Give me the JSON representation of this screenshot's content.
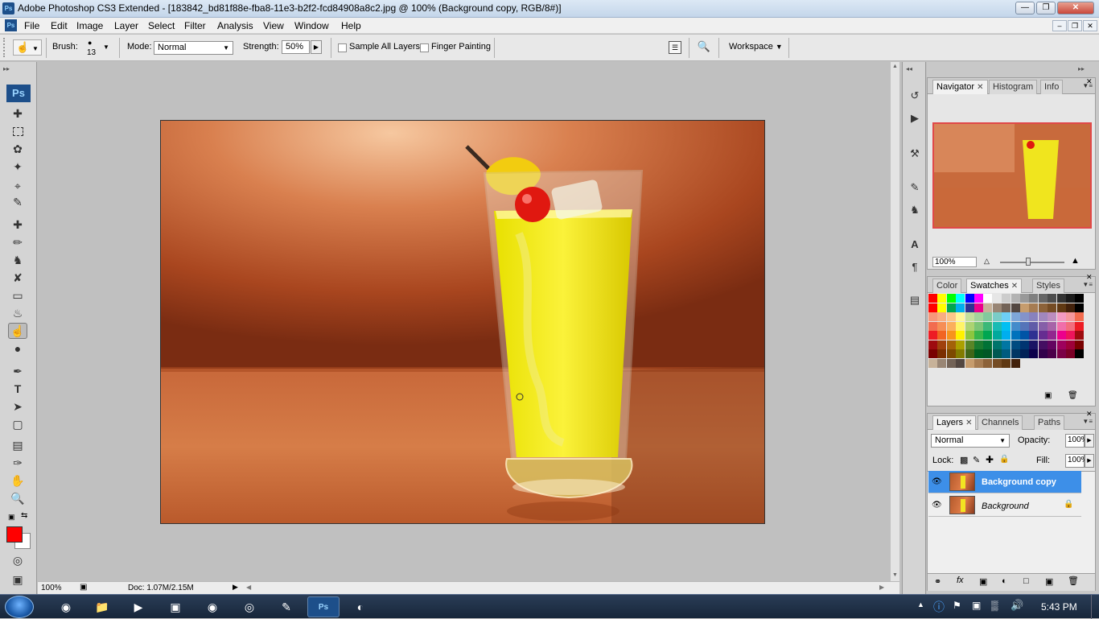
{
  "window": {
    "title": "Adobe Photoshop CS3 Extended - [183842_bd81f88e-fba8-11e3-b2f2-fcd84908a8c2.jpg @ 100% (Background copy, RGB/8#)]",
    "app_icon": "Ps"
  },
  "menu": [
    "File",
    "Edit",
    "Image",
    "Layer",
    "Select",
    "Filter",
    "Analysis",
    "View",
    "Window",
    "Help"
  ],
  "options": {
    "brush_label": "Brush:",
    "brush_size": "13",
    "mode_label": "Mode:",
    "mode_value": "Normal",
    "strength_label": "Strength:",
    "strength_value": "50%",
    "sample_all_layers": "Sample All Layers",
    "finger_painting": "Finger Painting",
    "workspace": "Workspace"
  },
  "tools_header": "Ps",
  "status": {
    "zoom": "100%",
    "doc": "Doc: 1.07M/2.15M"
  },
  "navigator": {
    "tabs": [
      "Navigator",
      "Histogram",
      "Info"
    ],
    "zoom": "100%"
  },
  "swatches": {
    "tabs": [
      "Color",
      "Swatches",
      "Styles"
    ],
    "rows": [
      [
        "#ff0000",
        "#ffff00",
        "#00ff00",
        "#00ffff",
        "#0000ff",
        "#ff00ff",
        "#ffffff",
        "#e6e6e6",
        "#cccccc",
        "#b3b3b3",
        "#999999",
        "#808080",
        "#666666",
        "#4d4d4d",
        "#333333",
        "#1a1a1a",
        "#000000"
      ],
      [
        "#ff0000",
        "#ffff00",
        "#00a651",
        "#00aeef",
        "#2e3192",
        "#ec008c",
        "#c7b299",
        "#998675",
        "#736357",
        "#534741",
        "#c69c6d",
        "#a67c52",
        "#8c6239",
        "#754c24",
        "#603913",
        "#42210b",
        "#000000"
      ],
      [
        "#f7977a",
        "#f9ad81",
        "#fdc68a",
        "#fff79a",
        "#c4df9b",
        "#a3d39c",
        "#82ca9d",
        "#7accc8",
        "#6dcff6",
        "#7ea7d8",
        "#8493ca",
        "#8882be",
        "#a187be",
        "#bc8dbf",
        "#f49ac2",
        "#f6989d",
        "#f26c4f"
      ],
      [
        "#f26c4f",
        "#f68e55",
        "#fbaf5c",
        "#fff467",
        "#acd372",
        "#7cc576",
        "#3bb878",
        "#1abbb4",
        "#00bff3",
        "#438ccb",
        "#5574b9",
        "#605ca8",
        "#855fa8",
        "#a763a8",
        "#f06eaa",
        "#f26d7d",
        "#ed1c24"
      ],
      [
        "#ed1c24",
        "#f26522",
        "#f7941d",
        "#fff200",
        "#8dc63f",
        "#39b54a",
        "#00a651",
        "#00a99d",
        "#00aeef",
        "#0072bc",
        "#0054a6",
        "#2e3192",
        "#662d91",
        "#92278f",
        "#ec008c",
        "#ed145b",
        "#9e0b0f"
      ],
      [
        "#9e0b0f",
        "#a0410d",
        "#a36209",
        "#aba000",
        "#598527",
        "#1a7b30",
        "#007236",
        "#00746b",
        "#0076a3",
        "#004b80",
        "#003471",
        "#1b1464",
        "#440e62",
        "#630460",
        "#9e005d",
        "#9e0039",
        "#790000"
      ],
      [
        "#790000",
        "#7b2e00",
        "#7d4900",
        "#827b00",
        "#406618",
        "#005e20",
        "#005826",
        "#005952",
        "#005b7f",
        "#003663",
        "#002157",
        "#0d004c",
        "#32004b",
        "#4b0049",
        "#7b0046",
        "#7a0026",
        "#000000"
      ],
      [
        "#c7b299",
        "#998675",
        "#736357",
        "#534741",
        "#c69c6d",
        "#a67c52",
        "#8c6239",
        "#754c24",
        "#603913",
        "#42210b"
      ]
    ]
  },
  "layers": {
    "tabs": [
      "Layers",
      "Channels",
      "Paths"
    ],
    "blend_mode": "Normal",
    "opacity_label": "Opacity:",
    "opacity_value": "100%",
    "lock_label": "Lock:",
    "fill_label": "Fill:",
    "fill_value": "100%",
    "items": [
      {
        "name": "Background copy"
      },
      {
        "name": "Background"
      }
    ]
  },
  "taskbar": {
    "clock": "5:43 PM"
  }
}
